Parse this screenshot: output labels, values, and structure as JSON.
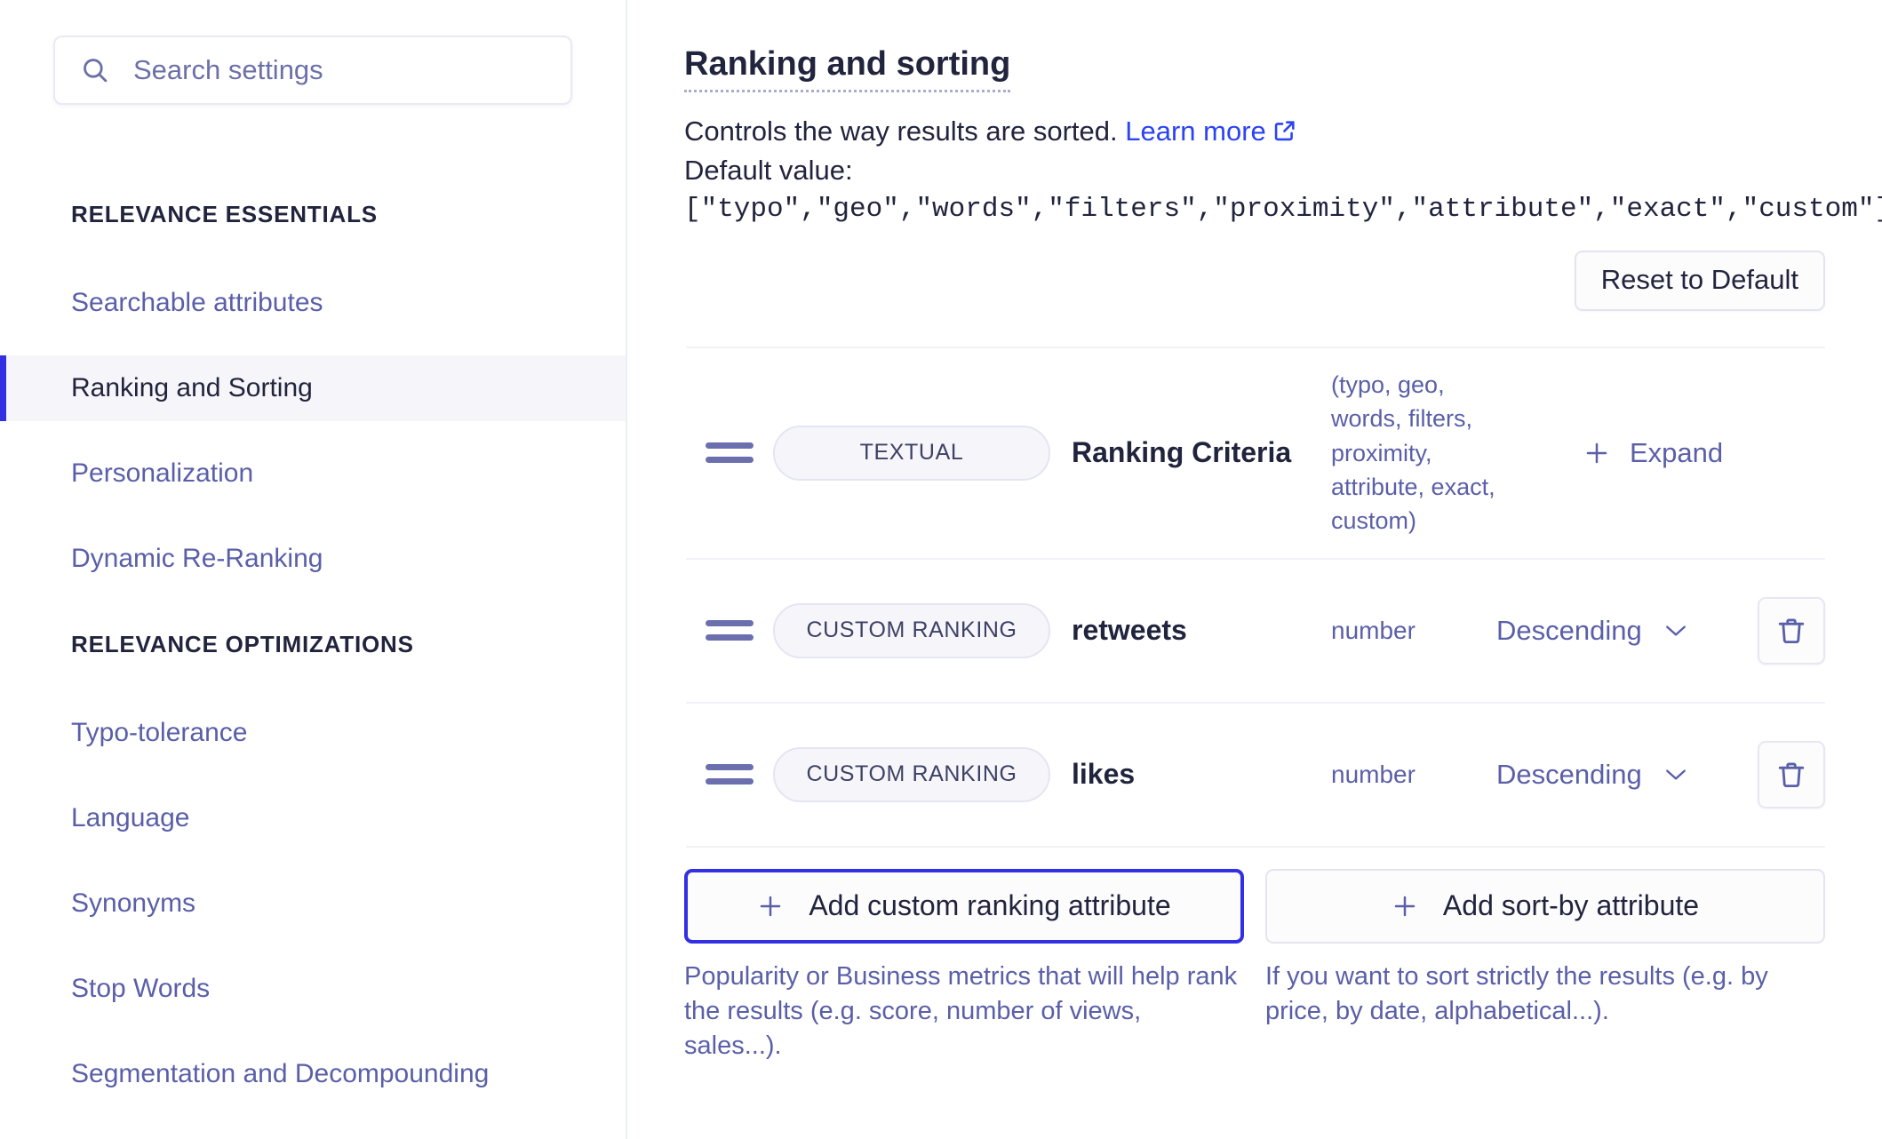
{
  "colors": {
    "accent": "#3330e4",
    "link": "#2b43f5",
    "muted_link": "#5a5fa8",
    "text": "#21243d",
    "active_bg": "#f6f6fa",
    "border": "#e3e4ef"
  },
  "sidebar": {
    "search": {
      "placeholder": "Search settings",
      "value": "",
      "icon": "search-icon"
    },
    "groups": [
      {
        "heading": "RELEVANCE ESSENTIALS",
        "items": [
          {
            "label": "Searchable attributes",
            "active": false
          },
          {
            "label": "Ranking and Sorting",
            "active": true
          },
          {
            "label": "Personalization",
            "active": false
          },
          {
            "label": "Dynamic Re-Ranking",
            "active": false
          }
        ]
      },
      {
        "heading": "RELEVANCE OPTIMIZATIONS",
        "items": [
          {
            "label": "Typo-tolerance",
            "active": false
          },
          {
            "label": "Language",
            "active": false
          },
          {
            "label": "Synonyms",
            "active": false
          },
          {
            "label": "Stop Words",
            "active": false
          },
          {
            "label": "Segmentation and Decompounding",
            "active": false
          }
        ]
      }
    ]
  },
  "main": {
    "title": "Ranking and sorting",
    "description": "Controls the way results are sorted.",
    "learn_more": "Learn more",
    "learn_more_icon": "external-link-icon",
    "default_label": "Default value:",
    "default_value": "[\"typo\",\"geo\",\"words\",\"filters\",\"proximity\",\"attribute\",\"exact\",\"custom\"]",
    "reset_button": "Reset to Default",
    "rows": [
      {
        "kind": "criteria",
        "badge": "TEXTUAL",
        "name": "Ranking Criteria",
        "hint": "(typo, geo, words, filters, proximity, attribute, exact, custom)",
        "action": "Expand",
        "action_icon": "plus-icon",
        "handle_icon": "drag-handle-icon"
      },
      {
        "kind": "custom",
        "badge": "CUSTOM RANKING",
        "name": "retweets",
        "type": "number",
        "order": "Descending",
        "order_icon": "chevron-down-icon",
        "delete_icon": "trash-icon",
        "handle_icon": "drag-handle-icon"
      },
      {
        "kind": "custom",
        "badge": "CUSTOM RANKING",
        "name": "likes",
        "type": "number",
        "order": "Descending",
        "order_icon": "chevron-down-icon",
        "delete_icon": "trash-icon",
        "handle_icon": "drag-handle-icon"
      }
    ],
    "add_custom": {
      "label": "Add custom ranking attribute",
      "icon": "plus-icon",
      "focused": true,
      "hint": "Popularity or Business metrics that will help rank the results (e.g. score, number of views, sales...)."
    },
    "add_sort": {
      "label": "Add sort-by attribute",
      "icon": "plus-icon",
      "focused": false,
      "hint": "If you want to sort strictly the results (e.g. by price, by date, alphabetical...)."
    }
  }
}
